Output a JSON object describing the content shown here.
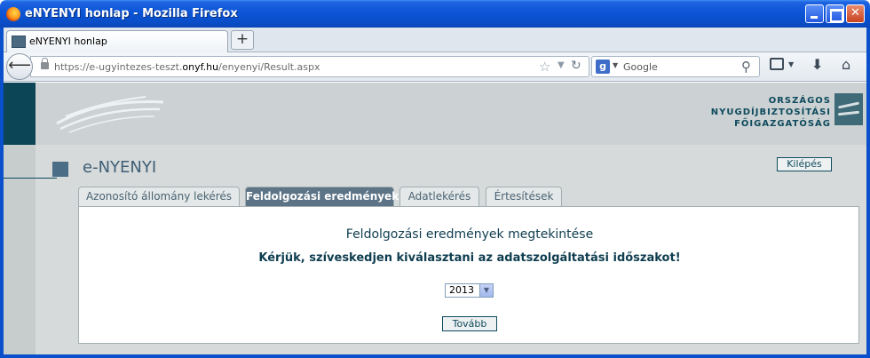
{
  "window": {
    "title": "eNYENYI honlap - Mozilla Firefox"
  },
  "browser": {
    "tab_label": "eNYENYI honlap",
    "new_tab_label": "+",
    "url_prefix": "https://e-ugyintezes-teszt.",
    "url_domain": "onyf.hu",
    "url_path": "/enyenyi/Result.aspx",
    "search_placeholder": "Google",
    "search_engine_letter": "g"
  },
  "site": {
    "logo_lines": [
      "ORSZÁGOS",
      "NYUGDÍJBIZTOSÍTÁSI",
      "FŐIGAZGATÓSÁG"
    ],
    "app_title": "e-NYENYI",
    "logout_label": "Kilépés",
    "tabs": [
      {
        "label": "Azonosító állomány lekérés",
        "active": false
      },
      {
        "label": "Feldolgozási eredmények",
        "active": true
      },
      {
        "label": "Adatlekérés",
        "active": false
      },
      {
        "label": "Értesítések",
        "active": false
      }
    ]
  },
  "main": {
    "heading": "Feldolgozási eredmények megtekintése",
    "prompt": "Kérjük, szíveskedjen kiválasztani az adatszolgáltatási időszakot!",
    "year_selected": "2013",
    "next_label": "Tovább"
  },
  "colors": {
    "brand": "#0e4a5d",
    "active_tab": "#5c7486",
    "titlebar": "#0a4ec8"
  }
}
